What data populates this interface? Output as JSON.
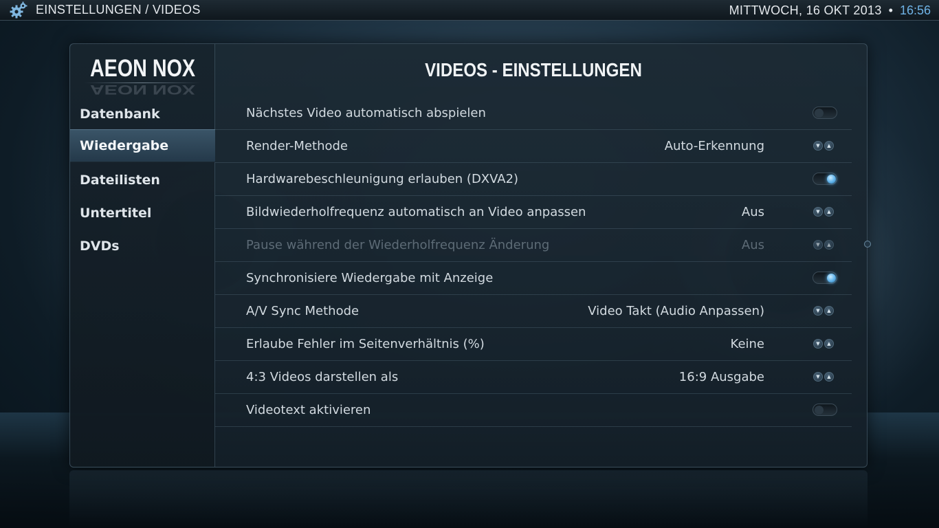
{
  "header": {
    "breadcrumb": "EINSTELLUNGEN / VIDEOS",
    "date": "MITTWOCH, 16 OKT 2013",
    "separator": "•",
    "time": "16:56",
    "icon": "gear-icon"
  },
  "sidebar": {
    "logo": "AEON NOX",
    "items": [
      {
        "label": "Datenbank",
        "active": false
      },
      {
        "label": "Wiedergabe",
        "active": true
      },
      {
        "label": "Dateilisten",
        "active": false
      },
      {
        "label": "Untertitel",
        "active": false
      },
      {
        "label": "DVDs",
        "active": false
      }
    ]
  },
  "main": {
    "title": "VIDEOS - EINSTELLUNGEN",
    "settings": [
      {
        "label": "Nächstes Video automatisch abspielen",
        "value": "",
        "control": "toggle",
        "state": "off",
        "enabled": true
      },
      {
        "label": "Render-Methode",
        "value": "Auto-Erkennung",
        "control": "spinner",
        "enabled": true
      },
      {
        "label": "Hardwarebeschleunigung erlauben (DXVA2)",
        "value": "",
        "control": "toggle",
        "state": "on",
        "enabled": true
      },
      {
        "label": "Bildwiederholfrequenz automatisch an Video anpassen",
        "value": "Aus",
        "control": "spinner",
        "enabled": true
      },
      {
        "label": "Pause während der Wiederholfrequenz Änderung",
        "value": "Aus",
        "control": "spinner",
        "enabled": false
      },
      {
        "label": "Synchronisiere Wiedergabe mit Anzeige",
        "value": "",
        "control": "toggle",
        "state": "on",
        "enabled": true
      },
      {
        "label": "A/V Sync Methode",
        "value": "Video Takt (Audio Anpassen)",
        "control": "spinner",
        "enabled": true
      },
      {
        "label": "Erlaube Fehler im Seitenverhältnis (%)",
        "value": "Keine",
        "control": "spinner",
        "enabled": true
      },
      {
        "label": "4:3 Videos darstellen als",
        "value": "16:9 Ausgabe",
        "control": "spinner",
        "enabled": true
      },
      {
        "label": "Videotext aktivieren",
        "value": "",
        "control": "toggle",
        "state": "off",
        "enabled": true
      }
    ],
    "spinner_glyphs": {
      "down": "▼",
      "up": "▲"
    }
  },
  "colors": {
    "accent": "#6fb3e6",
    "text": "#d2dae0",
    "disabled_text": "#5d6b76",
    "panel": "#1c2a34"
  }
}
